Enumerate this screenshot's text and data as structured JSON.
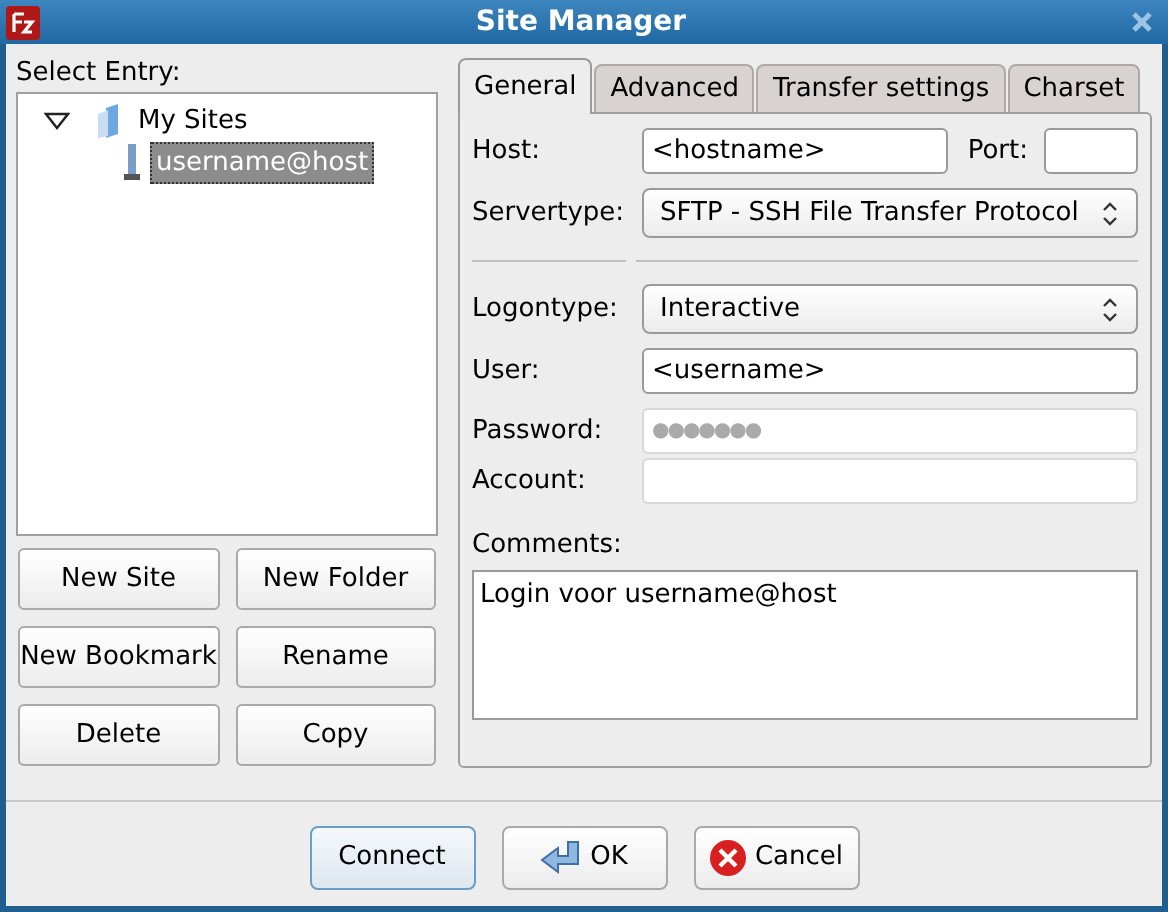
{
  "window": {
    "title": "Site Manager"
  },
  "select_entry_label": "Select Entry:",
  "tree": [
    {
      "label": "My Sites",
      "kind": "folder",
      "expanded": true,
      "selected": false,
      "children": [
        {
          "label": "username@host",
          "kind": "site",
          "selected": true
        }
      ]
    }
  ],
  "left_buttons": [
    "New Site",
    "New Folder",
    "New Bookmark",
    "Rename",
    "Delete",
    "Copy"
  ],
  "tabs": [
    {
      "label": "General",
      "selected": true
    },
    {
      "label": "Advanced",
      "selected": false
    },
    {
      "label": "Transfer settings",
      "selected": false
    },
    {
      "label": "Charset",
      "selected": false
    }
  ],
  "general": {
    "host": {
      "label": "Host:",
      "value": "<hostname>"
    },
    "port": {
      "label": "Port:"
    },
    "servertype": {
      "label": "Servertype:",
      "value": "SFTP - SSH File Transfer Protocol"
    },
    "logontype": {
      "label": "Logontype:",
      "value": "Interactive"
    },
    "user": {
      "label": "User:",
      "value": "<username>",
      "disabled": false
    },
    "password": {
      "label": "Password:",
      "value": "●●●●●●●",
      "disabled": true
    },
    "account": {
      "label": "Account:",
      "disabled": true
    },
    "comments": {
      "label": "Comments:",
      "value": "Login voor username@host"
    }
  },
  "dialog_buttons": [
    {
      "label": "Connect",
      "kind": "default"
    },
    {
      "label": "OK",
      "kind": "ok"
    },
    {
      "label": "Cancel",
      "kind": "cancel"
    }
  ]
}
